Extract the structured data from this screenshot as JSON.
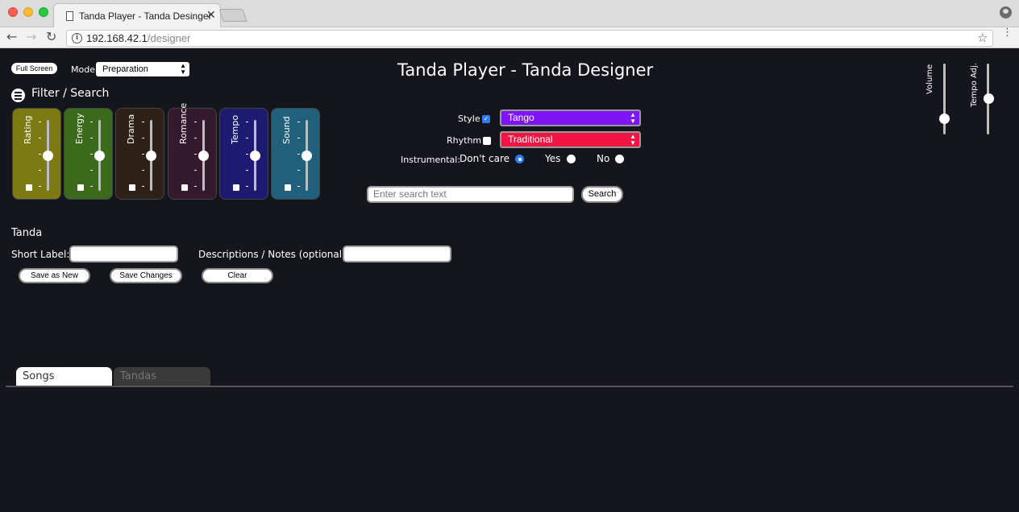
{
  "browser": {
    "tab_title": "Tanda Player - Tanda Desinger",
    "tab_close": "✕",
    "url_host": "192.168.42.1",
    "url_path": "/designer",
    "info_glyph": "i",
    "back_glyph": "←",
    "forward_glyph": "→",
    "reload_glyph": "↻",
    "star_glyph": "☆",
    "menu_glyph": "⋮"
  },
  "header": {
    "full_screen_button": "Full Screen",
    "mode_label": "Mode:",
    "mode_value": "Preparation",
    "title": "Tanda Player - Tanda Designer"
  },
  "filter": {
    "title": "Filter / Search",
    "sliders": [
      {
        "label": "Rating",
        "color": "#7d7a14",
        "level": 0.5
      },
      {
        "label": "Energy",
        "color": "#3c6a1c",
        "level": 0.5
      },
      {
        "label": "Drama",
        "color": "#2e2118",
        "level": 0.5
      },
      {
        "label": "Romance",
        "color": "#341a2c",
        "level": 0.5
      },
      {
        "label": "Tempo",
        "color": "#1e1a72",
        "level": 0.5
      },
      {
        "label": "Sound",
        "color": "#21607c",
        "level": 0.5
      }
    ],
    "style_label": "Style",
    "style_checked": "✓",
    "style_value": "Tango",
    "rhythm_label": "Rhythm",
    "rhythm_value": "Traditional",
    "instrumental_label": "Instrumental:",
    "instrumental_options": [
      "Don't care",
      "Yes",
      "No"
    ],
    "search_placeholder": "Enter search text",
    "search_button": "Search"
  },
  "controls": {
    "volume_label": "Volume",
    "tempo_adj_label": "Tempo Adj."
  },
  "tanda": {
    "heading": "Tanda",
    "short_label": "Short Label:",
    "desc_label": "Descriptions / Notes (optional):",
    "save_as_new": "Save as New",
    "save_changes": "Save Changes",
    "clear": "Clear"
  },
  "tabs": {
    "songs": "Songs",
    "tandas": "Tandas"
  }
}
